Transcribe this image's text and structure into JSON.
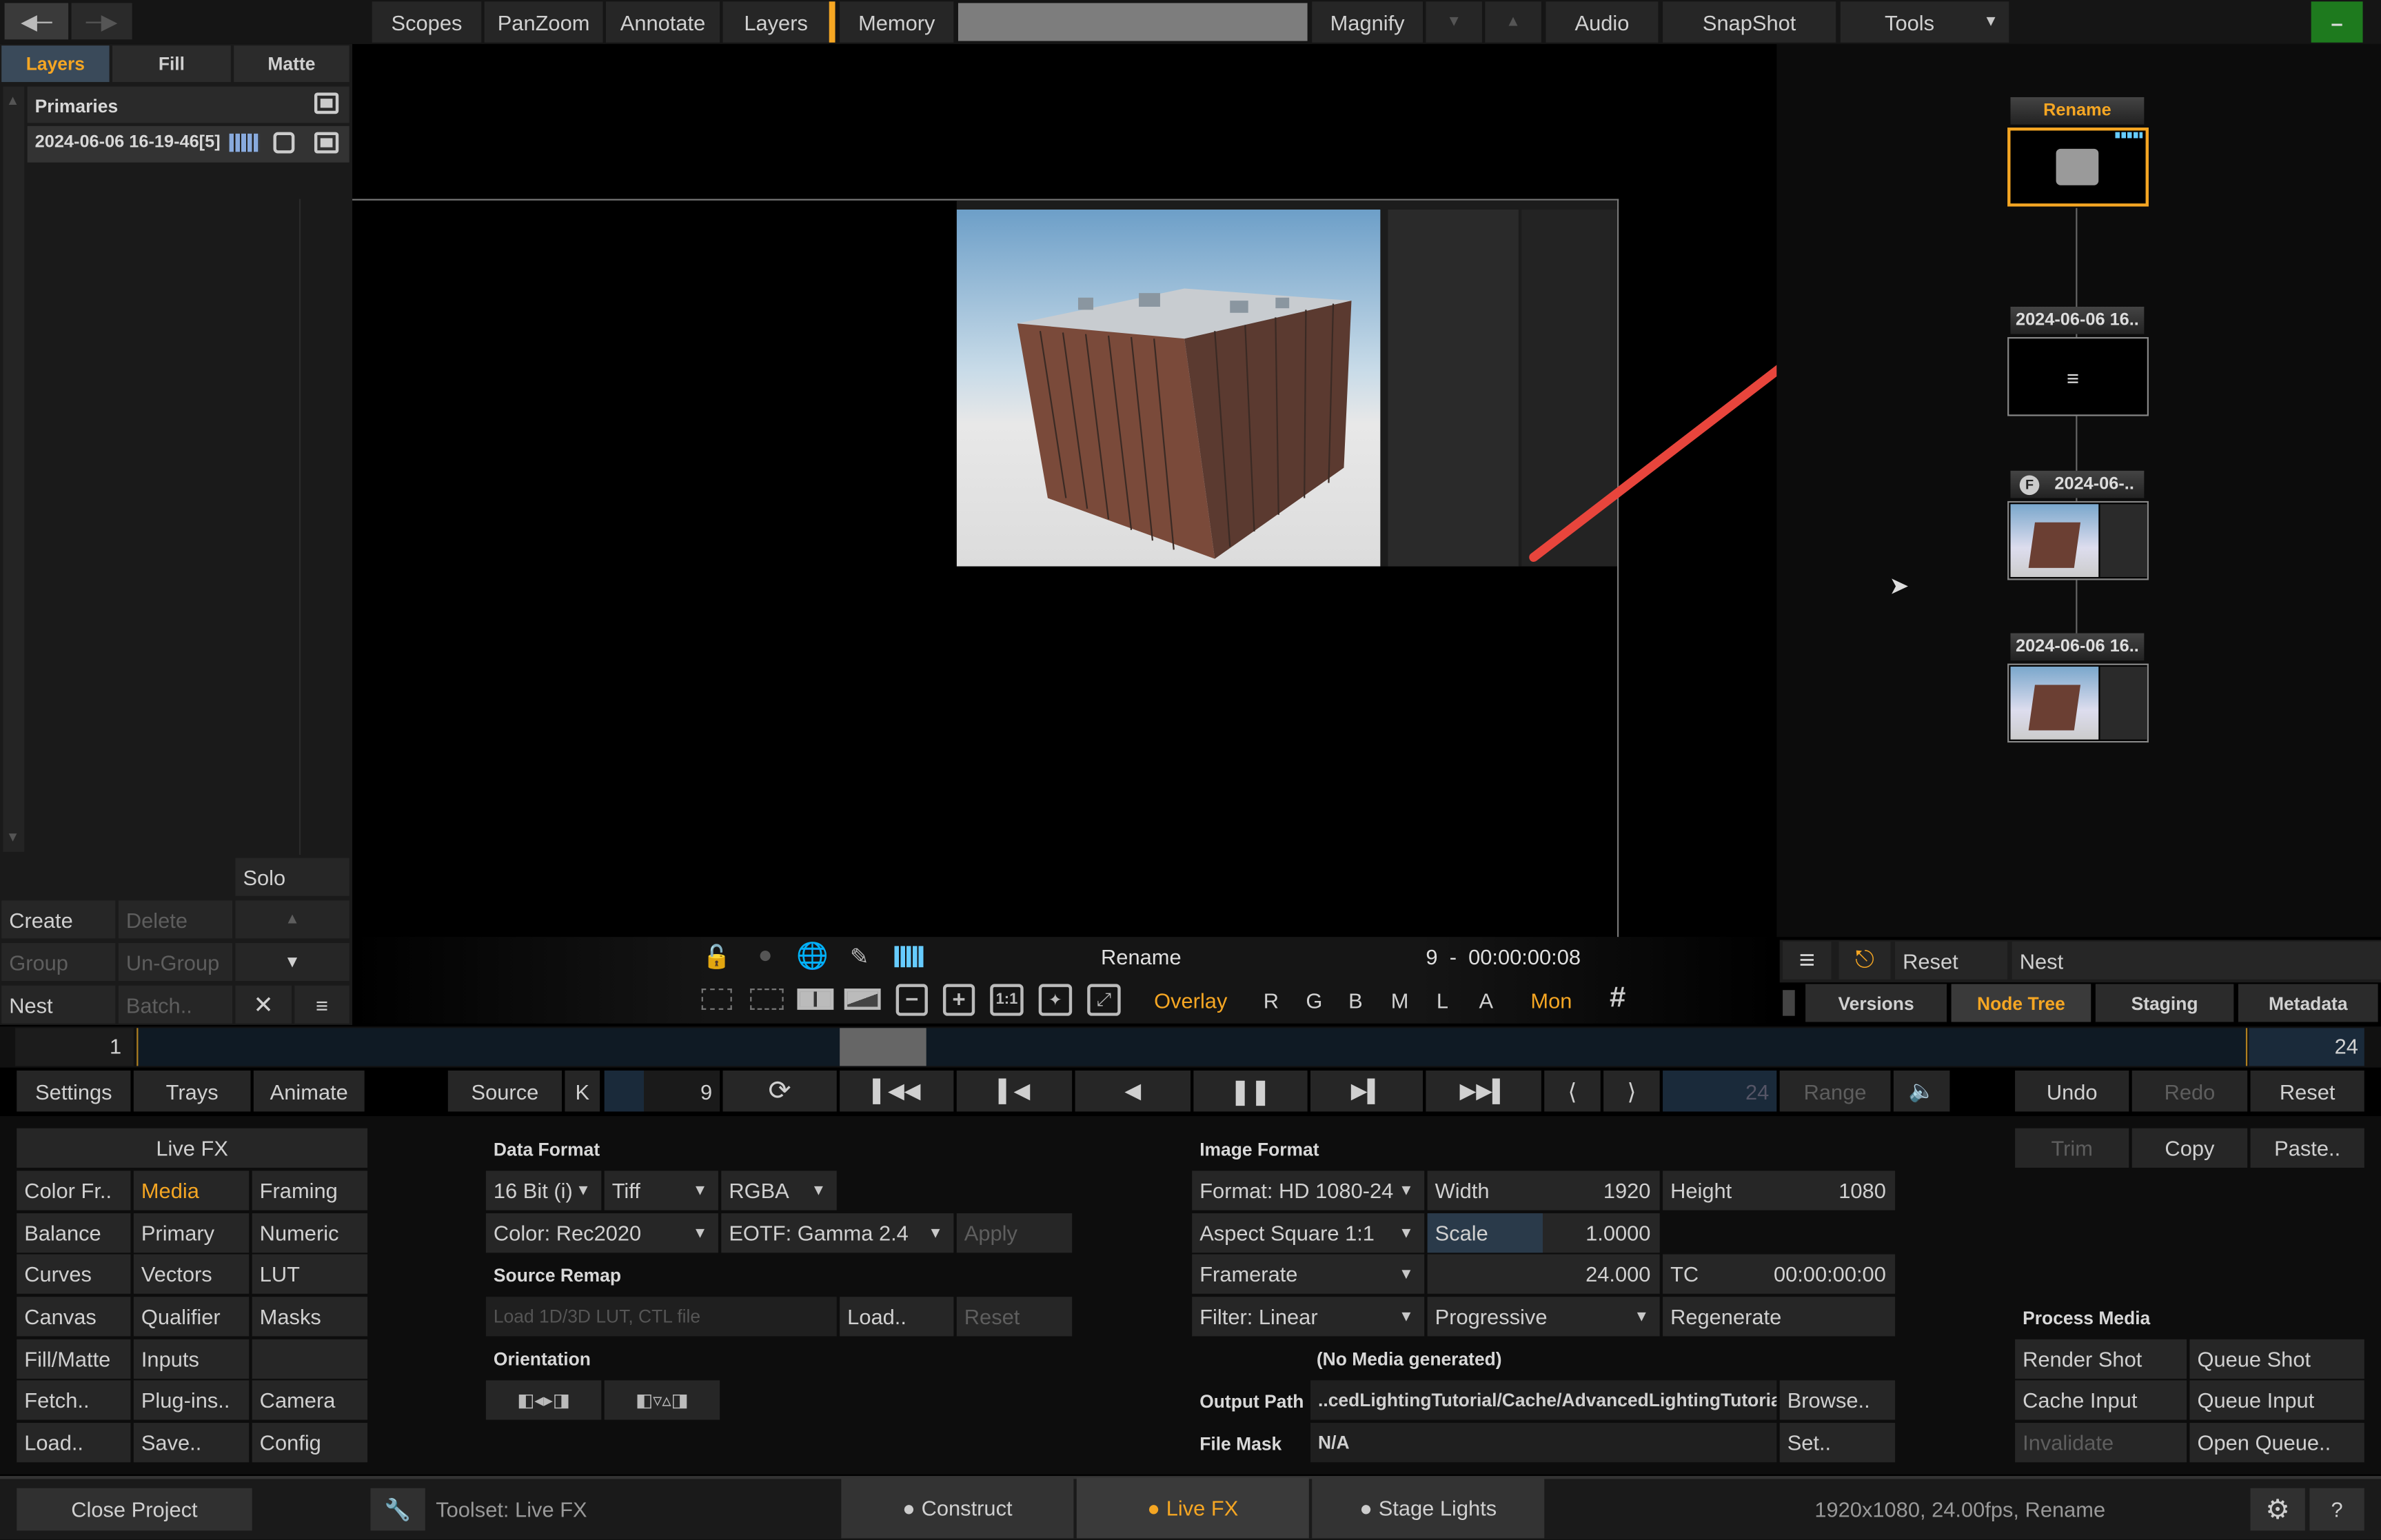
{
  "menubar": {
    "items": [
      "Scopes",
      "PanZoom",
      "Annotate",
      "Layers",
      "Memory",
      "Magnify",
      "Audio",
      "SnapShot",
      "Tools"
    ]
  },
  "left_panel": {
    "tabs": [
      "Layers",
      "Fill",
      "Matte"
    ],
    "primaries_label": "Primaries",
    "layer_name": "2024-06-06 16-19-46[5]",
    "solo": "Solo",
    "create": "Create",
    "delete": "Delete",
    "group": "Group",
    "ungroup": "Un-Group",
    "nest": "Nest",
    "batch": "Batch.."
  },
  "viewer": {
    "shot_name": "Rename",
    "frame_tc": "9  -  00:00:00:08",
    "overlay": "Overlay",
    "channels": [
      "R",
      "G",
      "B",
      "M",
      "L",
      "A"
    ],
    "mon": "Mon"
  },
  "node_tree": {
    "nodes": [
      {
        "label": "Rename"
      },
      {
        "label": "2024-06-06 16.."
      },
      {
        "label": "2024-06-.."
      },
      {
        "label": "2024-06-06 16.."
      }
    ],
    "reset": "Reset",
    "nest": "Nest",
    "tabs": [
      "Versions",
      "Node Tree",
      "Staging",
      "Metadata"
    ]
  },
  "timeline": {
    "start": "1",
    "end": "24"
  },
  "transport": {
    "settings": "Settings",
    "trays": "Trays",
    "animate": "Animate",
    "source": "Source",
    "k": "K",
    "frame": "9",
    "end_frame": "24",
    "range": "Range",
    "undo": "Undo",
    "redo": "Redo",
    "reset": "Reset"
  },
  "livefx": {
    "header": "Live FX",
    "items": [
      [
        "Color Fr..",
        "Media",
        "Framing"
      ],
      [
        "Balance",
        "Primary",
        "Numeric"
      ],
      [
        "Curves",
        "Vectors",
        "LUT"
      ],
      [
        "Canvas",
        "Qualifier",
        "Masks"
      ],
      [
        "Fill/Matte",
        "Inputs",
        ""
      ],
      [
        "Fetch..",
        "Plug-ins..",
        "Camera"
      ],
      [
        "Load..",
        "Save..",
        "Config"
      ]
    ]
  },
  "data_format": {
    "label": "Data Format",
    "bit": "16 Bit (i)",
    "file": "Tiff",
    "channels": "RGBA",
    "color": "Color: Rec2020",
    "eotf": "EOTF: Gamma 2.4",
    "apply": "Apply",
    "source_remap": "Source Remap",
    "lut_placeholder": "Load 1D/3D LUT, CTL file",
    "load": "Load..",
    "reset": "Reset",
    "orientation": "Orientation"
  },
  "image_format": {
    "label": "Image Format",
    "format": "Format: HD 1080-24",
    "width_label": "Width",
    "width": "1920",
    "height_label": "Height",
    "height": "1080",
    "aspect": "Aspect Square 1:1",
    "scale_label": "Scale",
    "scale": "1.0000",
    "framerate": "Framerate",
    "fps": "24.000",
    "tc_label": "TC",
    "tc": "00:00:00:00",
    "filter": "Filter: Linear",
    "scan": "Progressive",
    "regenerate": "Regenerate",
    "no_media": "(No Media generated)",
    "output_path_label": "Output Path",
    "output_path": "..cedLightingTutorial/Cache/AdvancedLightingTutorial/",
    "browse": "Browse..",
    "file_mask_label": "File Mask",
    "file_mask": "N/A",
    "set": "Set.."
  },
  "right_actions": {
    "trim": "Trim",
    "copy": "Copy",
    "paste": "Paste..",
    "process_media": "Process Media",
    "render_shot": "Render Shot",
    "queue_shot": "Queue Shot",
    "cache_input": "Cache Input",
    "queue_input": "Queue Input",
    "invalidate": "Invalidate",
    "open_queue": "Open Queue.."
  },
  "bottombar": {
    "close_project": "Close Project",
    "toolset": "Toolset: Live FX",
    "construct": "Construct",
    "livefx": "Live FX",
    "stage_lights": "Stage Lights",
    "status": "1920x1080, 24.00fps, Rename",
    "help": "?"
  },
  "colors": {
    "accent": "#f5a623",
    "arrow": "#e8453c",
    "panel": "#262626",
    "green": "#1e7a1e"
  }
}
